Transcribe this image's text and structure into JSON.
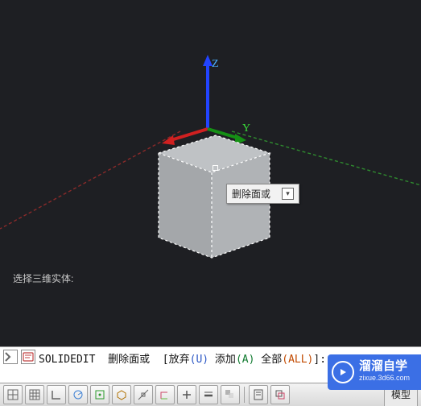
{
  "viewport": {
    "axis_label_z": "Z",
    "axis_label_y": "Y",
    "tooltip_text": "删除面或",
    "prompt_history": "选择三维实体:"
  },
  "command_line": {
    "command": "SOLIDEDIT",
    "label_remove": "删除面或",
    "opt_open": "[",
    "opt_giveup_label": "放弃",
    "opt_giveup_key": "(U)",
    "opt_add_label": " 添加",
    "opt_add_key": "(A)",
    "opt_all_label": " 全部",
    "opt_all_key": "(ALL)",
    "opt_close": "]:"
  },
  "toolbar": {
    "model_tab": "模型"
  },
  "watermark": {
    "main": "溜溜自学",
    "sub": "zixue.3d66.com"
  }
}
